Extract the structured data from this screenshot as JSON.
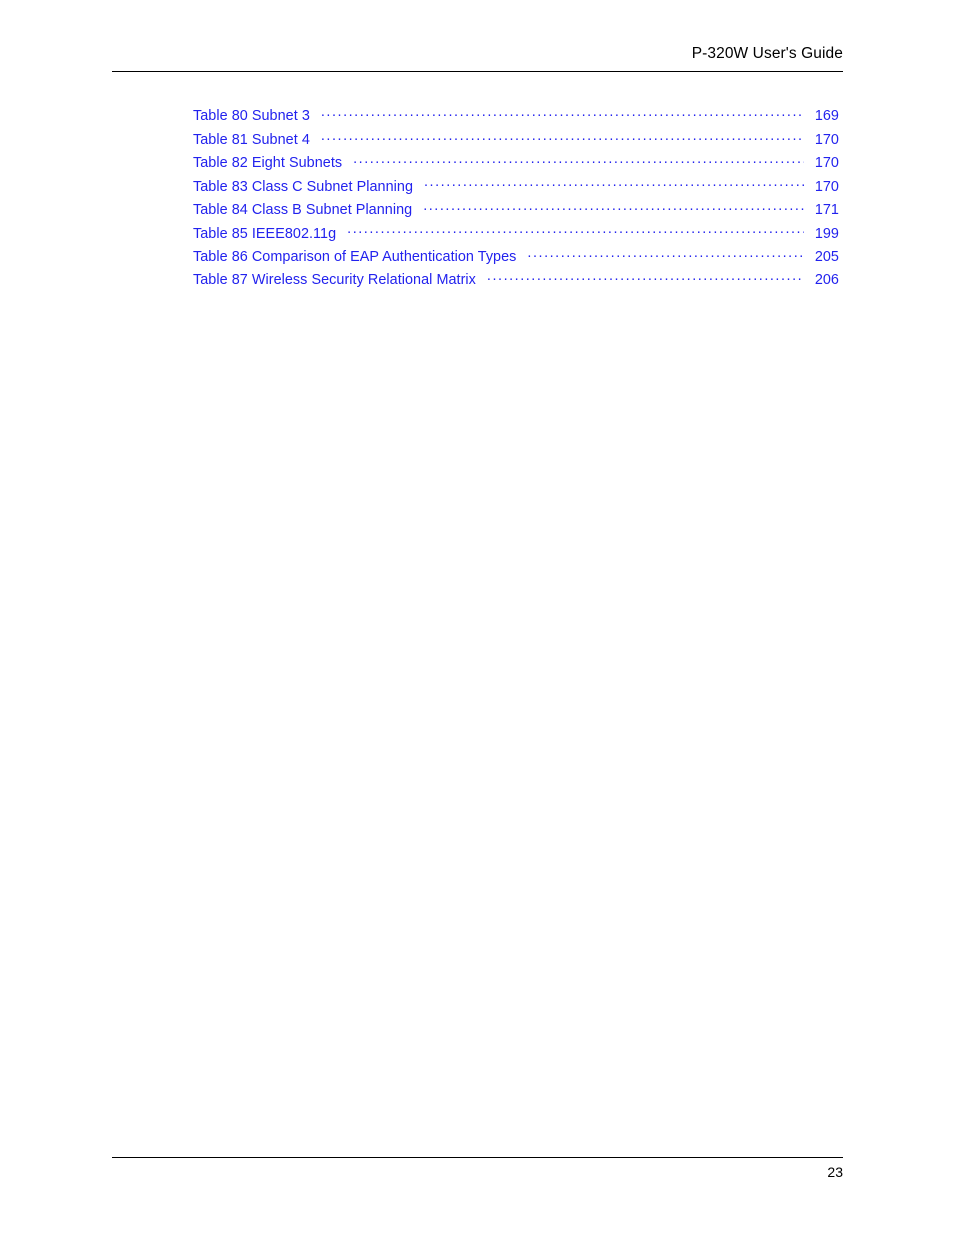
{
  "header": {
    "title": "P-320W User's Guide"
  },
  "toc": {
    "entries": [
      {
        "label": "Table 80 Subnet 3",
        "page": "169"
      },
      {
        "label": "Table 81 Subnet 4",
        "page": "170"
      },
      {
        "label": "Table 82 Eight Subnets",
        "page": "170"
      },
      {
        "label": "Table 83 Class C Subnet Planning",
        "page": "170"
      },
      {
        "label": "Table 84 Class B Subnet Planning",
        "page": "171"
      },
      {
        "label": "Table 85 IEEE802.11g",
        "page": "199"
      },
      {
        "label": "Table 86 Comparison of EAP Authentication Types",
        "page": "205"
      },
      {
        "label": "Table 87 Wireless Security Relational Matrix",
        "page": "206"
      }
    ]
  },
  "footer": {
    "page_number": "23"
  },
  "colors": {
    "link_blue": "#2222ee",
    "text_black": "#000000",
    "rule_black": "#000000",
    "page_background": "#ffffff"
  }
}
